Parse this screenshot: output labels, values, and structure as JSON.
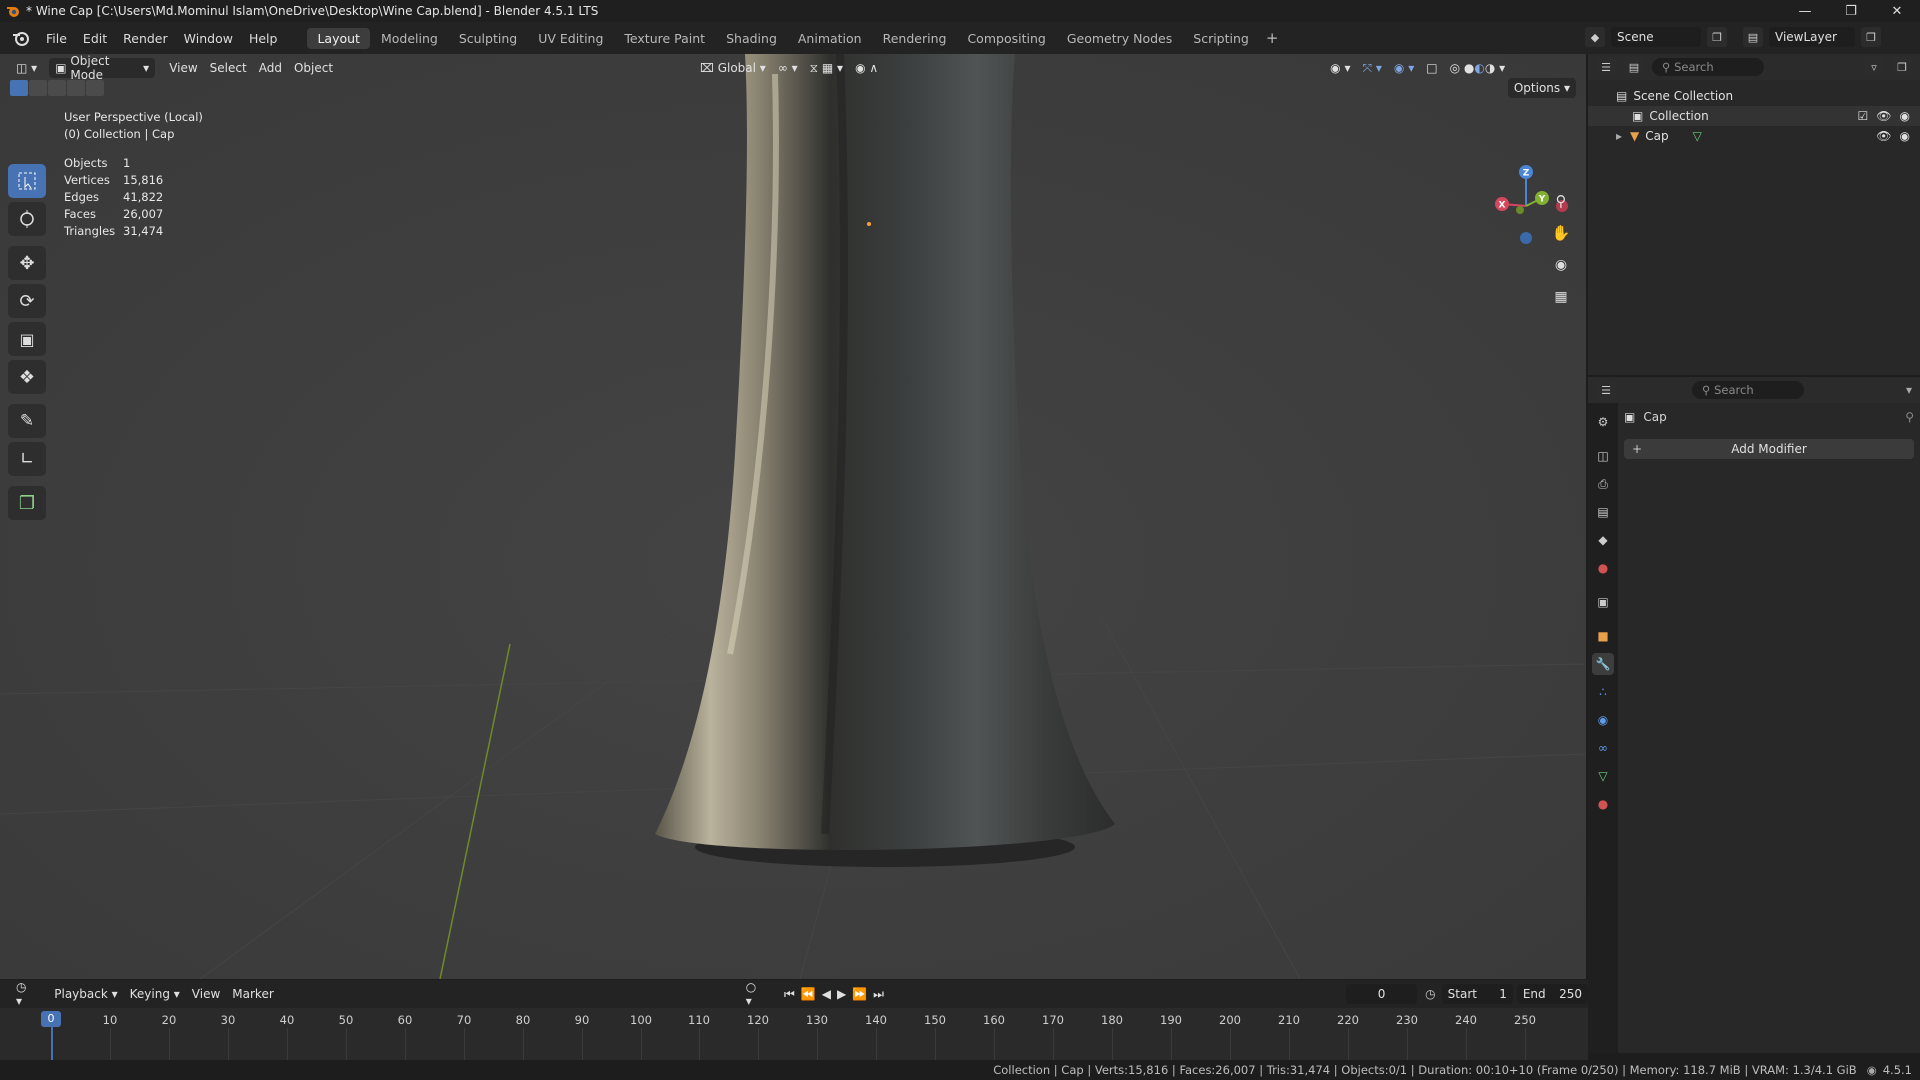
{
  "window": {
    "title": "* Wine Cap [C:\\Users\\Md.Mominul Islam\\OneDrive\\Desktop\\Wine Cap.blend] - Blender 4.5.1 LTS"
  },
  "menu": [
    "File",
    "Edit",
    "Render",
    "Window",
    "Help"
  ],
  "workspaces": [
    "Layout",
    "Modeling",
    "Sculpting",
    "UV Editing",
    "Texture Paint",
    "Shading",
    "Animation",
    "Rendering",
    "Compositing",
    "Geometry Nodes",
    "Scripting"
  ],
  "active_workspace": "Layout",
  "scene": {
    "name": "Scene",
    "view_layer": "ViewLayer"
  },
  "viewport": {
    "mode": "Object Mode",
    "menus": [
      "View",
      "Select",
      "Add",
      "Object"
    ],
    "orientation": "Global",
    "options_label": "Options",
    "perspective": "User Perspective (Local)",
    "context": "(0) Collection | Cap",
    "stats": [
      {
        "label": "Objects",
        "value": "1"
      },
      {
        "label": "Vertices",
        "value": "15,816"
      },
      {
        "label": "Edges",
        "value": "41,822"
      },
      {
        "label": "Faces",
        "value": "26,007"
      },
      {
        "label": "Triangles",
        "value": "31,474"
      }
    ],
    "gizmo": {
      "x": "X",
      "y": "Y",
      "z": "Z"
    }
  },
  "outliner": {
    "search_placeholder": "Search",
    "root": "Scene Collection",
    "collection": "Collection",
    "object": "Cap"
  },
  "properties": {
    "search_placeholder": "Search",
    "object_name": "Cap",
    "add_modifier_label": "Add Modifier"
  },
  "timeline": {
    "menus": [
      "Playback",
      "Keying",
      "View",
      "Marker"
    ],
    "current_frame": "0",
    "start_label": "Start",
    "start_value": "1",
    "end_label": "End",
    "end_value": "250",
    "ticks": [
      "0",
      "10",
      "20",
      "30",
      "40",
      "50",
      "60",
      "70",
      "80",
      "90",
      "100",
      "110",
      "120",
      "130",
      "140",
      "150",
      "160",
      "170",
      "180",
      "190",
      "200",
      "210",
      "220",
      "230",
      "240",
      "250"
    ]
  },
  "statusbar": {
    "text": "Collection | Cap | Verts:15,816 | Faces:26,007 | Tris:31,474 | Objects:0/1 | Duration: 00:10+10 (Frame 0/250) | Memory: 118.7 MiB | VRAM: 1.3/4.1 GiB",
    "version": "4.5.1"
  },
  "colors": {
    "accent": "#4772b3",
    "viewport_bg": "#3d3d3d",
    "panel_bg": "#282828"
  }
}
